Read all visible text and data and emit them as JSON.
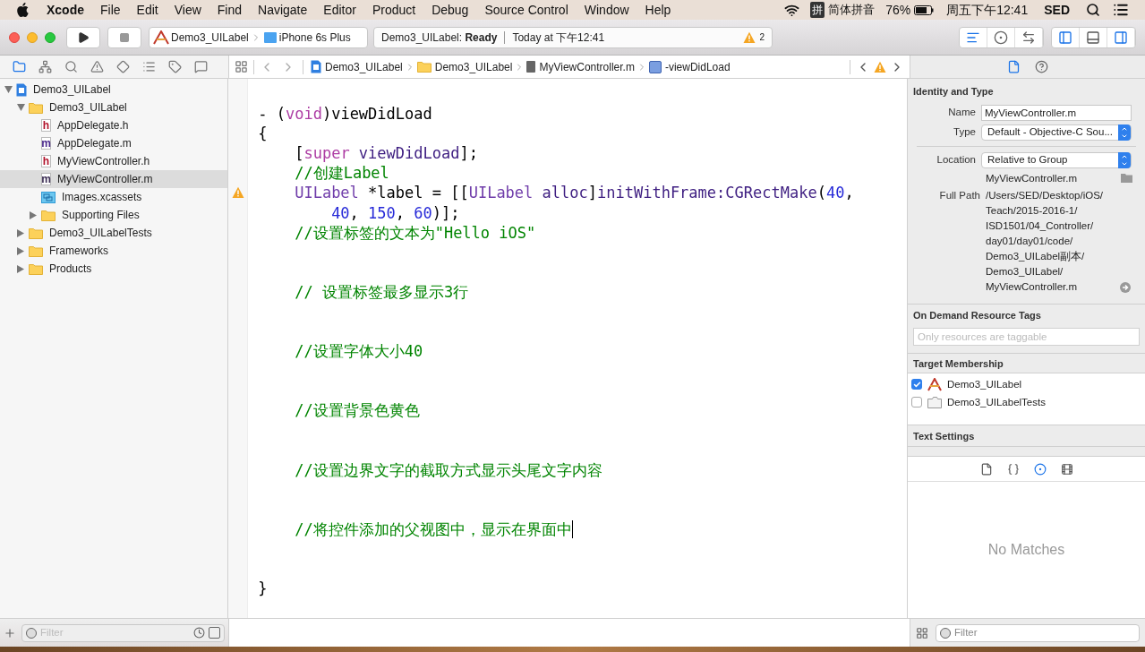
{
  "menu_bar": {
    "app": "Xcode",
    "menus": [
      "File",
      "Edit",
      "View",
      "Find",
      "Navigate",
      "Editor",
      "Product",
      "Debug",
      "Source Control",
      "Window",
      "Help"
    ],
    "input_badge": "拼",
    "input_method": "简体拼音",
    "battery": "76%",
    "clock": "周五下午12:41",
    "user": "SED"
  },
  "toolbar": {
    "scheme": "Demo3_UILabel",
    "device": "iPhone 6s Plus",
    "status": "Demo3_UILabel: **Ready**",
    "time": "Today at 下午12:41",
    "warnings": "2",
    "editor_modes": [
      {
        "kind": "standard",
        "selected": true
      },
      {
        "kind": "assistant",
        "selected": false
      },
      {
        "kind": "version",
        "selected": false
      }
    ],
    "panels": [
      {
        "kind": "navigator",
        "on": true
      },
      {
        "kind": "debug",
        "on": false
      },
      {
        "kind": "utilities",
        "on": true
      }
    ]
  },
  "navigator": {
    "tabs": [
      {
        "kind": "folder",
        "selected": true
      },
      {
        "kind": "hierarchy",
        "selected": false
      },
      {
        "kind": "search",
        "selected": false
      },
      {
        "kind": "issue",
        "selected": false
      },
      {
        "kind": "test",
        "selected": false
      },
      {
        "kind": "debug",
        "selected": false
      },
      {
        "kind": "breakpoint",
        "selected": false
      },
      {
        "kind": "report",
        "selected": false
      }
    ],
    "tree": [
      {
        "kind": "project",
        "label": "Demo3_UILabel",
        "expanded": true,
        "selected": false,
        "children": [
          {
            "kind": "folder",
            "label": "Demo3_UILabel",
            "expanded": true,
            "selected": false,
            "children": [
              {
                "kind": "file",
                "letter": "h",
                "color": "#b1122a",
                "label": "AppDelegate.h",
                "selected": false
              },
              {
                "kind": "file",
                "letter": "m",
                "color": "#4b2a8c",
                "label": "AppDelegate.m",
                "selected": false
              },
              {
                "kind": "file",
                "letter": "h",
                "color": "#b1122a",
                "label": "MyViewController.h",
                "selected": false
              },
              {
                "kind": "file",
                "letter": "m",
                "color": "#3d2f55",
                "label": "MyViewController.m",
                "selected": true
              },
              {
                "kind": "assets",
                "label": "Images.xcassets",
                "selected": false
              },
              {
                "kind": "folder",
                "label": "Supporting Files",
                "expanded": false,
                "selected": false
              }
            ]
          },
          {
            "kind": "folder",
            "label": "Demo3_UILabelTests",
            "expanded": false,
            "selected": false
          },
          {
            "kind": "folder",
            "label": "Frameworks",
            "expanded": false,
            "selected": false
          },
          {
            "kind": "folder",
            "label": "Products",
            "expanded": false,
            "selected": false
          }
        ]
      }
    ],
    "filter": {
      "placeholder": "Filter"
    }
  },
  "jump_bar": {
    "crumbs": [
      {
        "kind": "project",
        "label": "Demo3_UILabel"
      },
      {
        "kind": "folder",
        "label": "Demo3_UILabel"
      },
      {
        "kind": "file",
        "label": "MyViewController.m"
      },
      {
        "kind": "method",
        "label": "-viewDidLoad"
      }
    ]
  },
  "editor": {
    "lines": [
      {
        "kind": "code",
        "warning": false,
        "cursor": false,
        "tokens": [
          {
            "kind": "plain",
            "text": "- ("
          },
          {
            "kind": "keyword",
            "text": "void"
          },
          {
            "kind": "plain",
            "text": ")viewDidLoad"
          }
        ]
      },
      {
        "kind": "code",
        "warning": false,
        "cursor": false,
        "tokens": [
          {
            "kind": "plain",
            "text": "{"
          }
        ]
      },
      {
        "kind": "code",
        "warning": false,
        "cursor": false,
        "tokens": [
          {
            "kind": "plain",
            "text": "    ["
          },
          {
            "kind": "keyword",
            "text": "super"
          },
          {
            "kind": "method",
            "text": " viewDidLoad"
          },
          {
            "kind": "plain",
            "text": "];"
          }
        ]
      },
      {
        "kind": "code",
        "warning": false,
        "cursor": false,
        "tokens": [
          {
            "kind": "comment",
            "text": "    //创建Label"
          }
        ]
      },
      {
        "kind": "code",
        "warning": true,
        "cursor": false,
        "tokens": [
          {
            "kind": "class",
            "text": "    UILabel"
          },
          {
            "kind": "plain",
            "text": " *label = [["
          },
          {
            "kind": "class",
            "text": "UILabel"
          },
          {
            "kind": "method",
            "text": " alloc"
          },
          {
            "kind": "plain",
            "text": "]"
          },
          {
            "kind": "method",
            "text": "initWithFrame:CGRectMake"
          },
          {
            "kind": "plain",
            "text": "("
          },
          {
            "kind": "number",
            "text": "40"
          },
          {
            "kind": "plain",
            "text": ","
          }
        ]
      },
      {
        "kind": "code",
        "warning": false,
        "cursor": false,
        "tokens": [
          {
            "kind": "number",
            "text": "        40"
          },
          {
            "kind": "plain",
            "text": ", "
          },
          {
            "kind": "number",
            "text": "150"
          },
          {
            "kind": "plain",
            "text": ", "
          },
          {
            "kind": "number",
            "text": "60"
          },
          {
            "kind": "plain",
            "text": ")];"
          }
        ]
      },
      {
        "kind": "code",
        "warning": false,
        "cursor": false,
        "tokens": [
          {
            "kind": "comment",
            "text": "    //设置标签的文本为\"Hello iOS\""
          }
        ]
      },
      {
        "kind": "blank"
      },
      {
        "kind": "blank"
      },
      {
        "kind": "code",
        "warning": false,
        "cursor": false,
        "tokens": [
          {
            "kind": "comment",
            "text": "    // 设置标签最多显示3行"
          }
        ]
      },
      {
        "kind": "blank"
      },
      {
        "kind": "blank"
      },
      {
        "kind": "code",
        "warning": false,
        "cursor": false,
        "tokens": [
          {
            "kind": "comment",
            "text": "    //设置字体大小40"
          }
        ]
      },
      {
        "kind": "blank"
      },
      {
        "kind": "blank"
      },
      {
        "kind": "code",
        "warning": false,
        "cursor": false,
        "tokens": [
          {
            "kind": "comment",
            "text": "    //设置背景色黄色"
          }
        ]
      },
      {
        "kind": "blank"
      },
      {
        "kind": "blank"
      },
      {
        "kind": "code",
        "warning": false,
        "cursor": false,
        "tokens": [
          {
            "kind": "comment",
            "text": "    //设置边界文字的截取方式显示头尾文字内容"
          }
        ]
      },
      {
        "kind": "blank"
      },
      {
        "kind": "blank"
      },
      {
        "kind": "code",
        "warning": false,
        "cursor": true,
        "tokens": [
          {
            "kind": "comment",
            "text": "    //将控件添加的父视图中，显示在界面中"
          }
        ]
      },
      {
        "kind": "blank"
      },
      {
        "kind": "blank"
      },
      {
        "kind": "code",
        "warning": false,
        "cursor": false,
        "tokens": [
          {
            "kind": "plain",
            "text": "}"
          }
        ]
      }
    ]
  },
  "inspector": {
    "tabs": [
      {
        "kind": "file",
        "selected": true
      },
      {
        "kind": "help",
        "selected": false
      }
    ],
    "identity": {
      "title": "Identity and Type",
      "name_label": "Name",
      "name_value": "MyViewController.m",
      "type_label": "Type",
      "type_value": "Default - Objective-C Sou...",
      "location_label": "Location",
      "location_value": "Relative to Group",
      "file_name": "MyViewController.m",
      "full_path_label": "Full Path",
      "full_path": "/Users/SED/Desktop/iOS/Teach/2015-2016-1/ISD1501/04_Controller/day01/day01/code/Demo3_UILabel副本/Demo3_UILabel/MyViewController.m"
    },
    "tags": {
      "title": "On Demand Resource Tags",
      "placeholder": "Only resources are taggable"
    },
    "membership": {
      "title": "Target Membership",
      "targets": [
        {
          "kind": "app",
          "label": "Demo3_UILabel",
          "checked": true
        },
        {
          "kind": "tests",
          "label": "Demo3_UILabelTests",
          "checked": false
        }
      ]
    },
    "text_settings": {
      "title": "Text Settings"
    },
    "library_tabs": [
      {
        "kind": "file",
        "selected": false
      },
      {
        "kind": "braces",
        "selected": false
      },
      {
        "kind": "object",
        "selected": true
      },
      {
        "kind": "media",
        "selected": false
      }
    ],
    "empty_text": "No Matches",
    "filter": {
      "placeholder": "Filter"
    }
  }
}
